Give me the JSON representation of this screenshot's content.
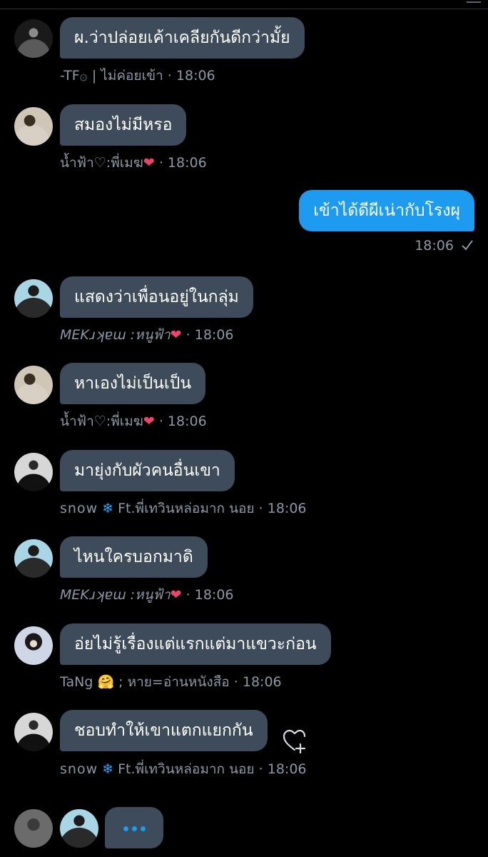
{
  "messages": [
    {
      "text": "ผ.ว่าปล่อยเค้าเคลียกันดีกว่ามั้ย",
      "sender": "-TF۞ | ไม่ค่อยเข้า",
      "time": "18:06"
    },
    {
      "text": "สมองไม่มีหรอ",
      "sender": "น้ำฟ้า♡:พี่เมฆ",
      "time": "18:06"
    },
    {
      "text": "แสดงว่าเพื่อนอยู่ในกลุ่ม",
      "sender": "MEKɹʞɐɯ :หนูฟ้า",
      "time": "18:06"
    },
    {
      "text": "หาเองไม่เป็นเป็น",
      "sender": "น้ำฟ้า♡:พี่เมฆ",
      "time": "18:06"
    },
    {
      "text": "มายุ่งกับผัวคนอื่นเขา",
      "sender": "snow",
      "sender_suffix": "Ft.พี่เทวินหล่อมาก นอย",
      "time": "18:06"
    },
    {
      "text": "ไหนใครบอกมาดิ",
      "sender": "MEKɹʞɐɯ :หนูฟ้า",
      "time": "18:06"
    },
    {
      "text": "อ่ยไม่รู้เรื่องแต่แรกแต่มาแขวะก่อน",
      "sender": "TaNg",
      "sender_suffix": "; หาย=อ่านหนังสือ",
      "time": "18:06"
    },
    {
      "text": "ชอบทำให้เขาแตกแยกกัน",
      "sender": "snow",
      "sender_suffix": "Ft.พี่เทวินหล่อมาก นอย",
      "time": "18:06"
    }
  ],
  "outgoing": {
    "text": "เข้าได้ดีผีเน่ากับโรงผุ",
    "time": "18:06",
    "status_icon": "check-icon"
  },
  "separator": "·",
  "emoji": {
    "heart": "❤",
    "snowflake": "❄",
    "hug": "🤗"
  },
  "colors": {
    "background": "#000000",
    "incoming_bubble": "#3d4b5a",
    "outgoing_bubble": "#1d9bf0",
    "meta": "#8b98a5",
    "heart": "#f0436a"
  }
}
